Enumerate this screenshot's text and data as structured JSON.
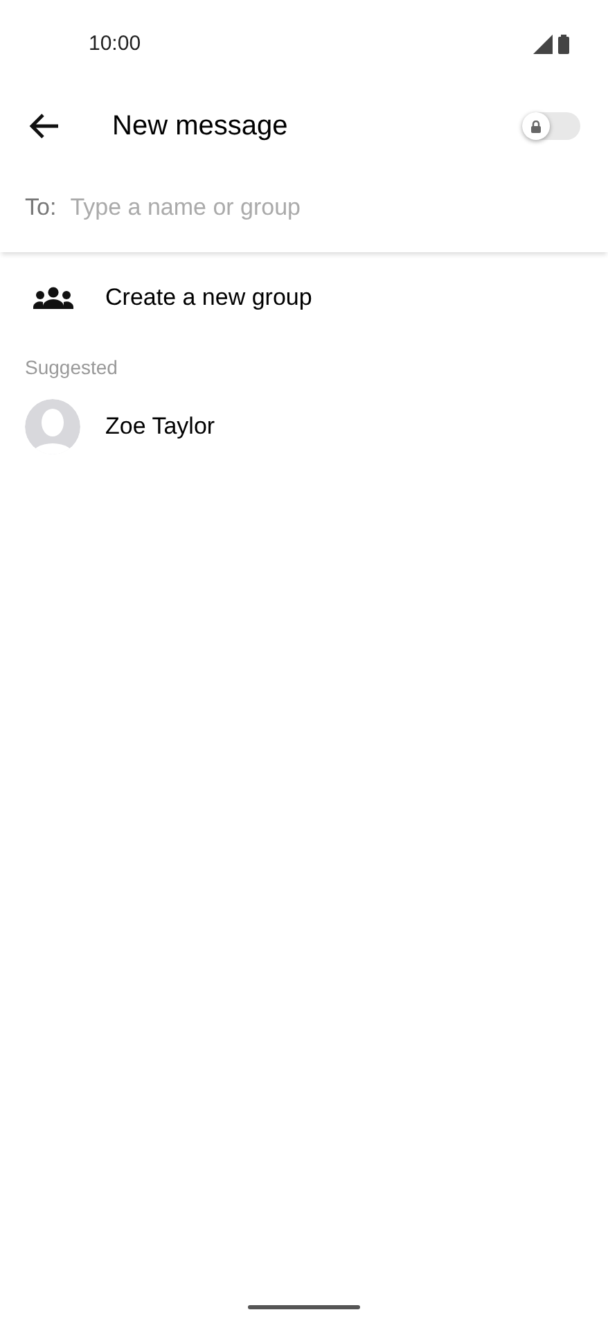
{
  "status_bar": {
    "time": "10:00"
  },
  "header": {
    "title": "New message",
    "secure_toggle": {
      "on": false
    }
  },
  "recipient": {
    "label": "To:",
    "placeholder": "Type a name or group"
  },
  "actions": [
    {
      "label": "Create a new group"
    }
  ],
  "suggested": {
    "heading": "Suggested",
    "contacts": [
      {
        "name": "Zoe Taylor"
      }
    ]
  }
}
